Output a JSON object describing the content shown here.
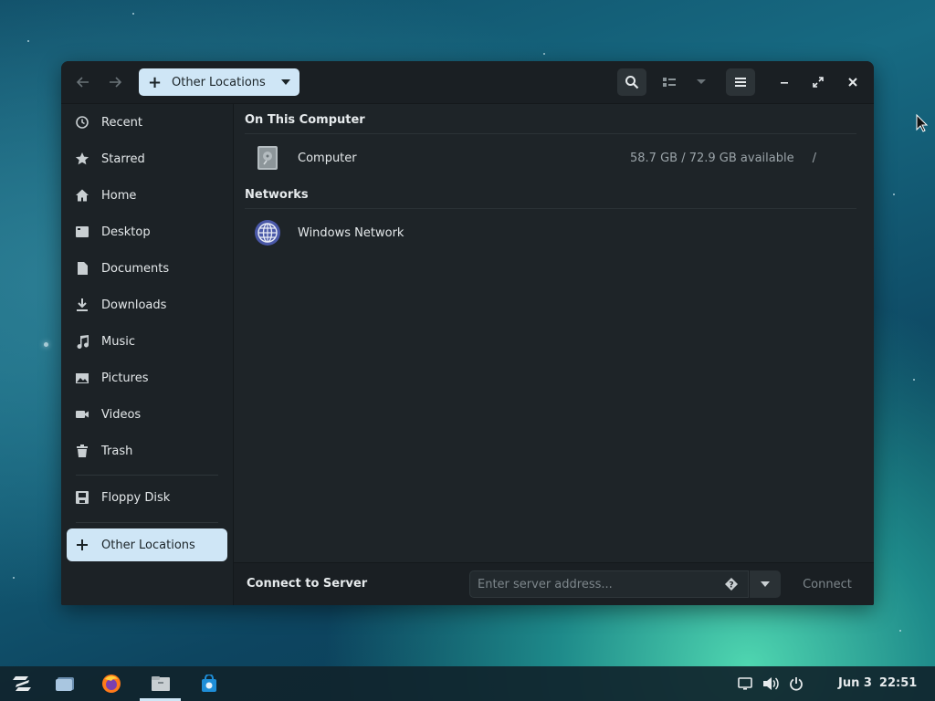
{
  "window": {
    "path_label": "Other Locations"
  },
  "sidebar": {
    "items": [
      {
        "label": "Recent",
        "icon": "clock-icon"
      },
      {
        "label": "Starred",
        "icon": "star-icon"
      },
      {
        "label": "Home",
        "icon": "home-icon"
      },
      {
        "label": "Desktop",
        "icon": "desktop-icon"
      },
      {
        "label": "Documents",
        "icon": "document-icon"
      },
      {
        "label": "Downloads",
        "icon": "download-icon"
      },
      {
        "label": "Music",
        "icon": "music-icon"
      },
      {
        "label": "Pictures",
        "icon": "picture-icon"
      },
      {
        "label": "Videos",
        "icon": "video-icon"
      },
      {
        "label": "Trash",
        "icon": "trash-icon"
      }
    ],
    "devices": [
      {
        "label": "Floppy Disk",
        "icon": "floppy-icon"
      }
    ],
    "other_locations": {
      "label": "Other Locations",
      "icon": "plus-icon",
      "active": true
    }
  },
  "main": {
    "sections": [
      {
        "title": "On This Computer",
        "rows": [
          {
            "name": "Computer",
            "info": "58.7 GB / 72.9 GB available",
            "path": "/",
            "icon": "harddisk-icon"
          }
        ]
      },
      {
        "title": "Networks",
        "rows": [
          {
            "name": "Windows Network",
            "info": "",
            "path": "",
            "icon": "globe-icon"
          }
        ]
      }
    ]
  },
  "bottom": {
    "title": "Connect to Server",
    "placeholder": "Enter server address...",
    "connect_label": "Connect"
  },
  "taskbar": {
    "date": "Jun 3",
    "time": "22:51"
  },
  "colors": {
    "accent": "#cfe6f6",
    "window_bg": "#1e2428",
    "headerbar_bg": "#1a1f23"
  }
}
